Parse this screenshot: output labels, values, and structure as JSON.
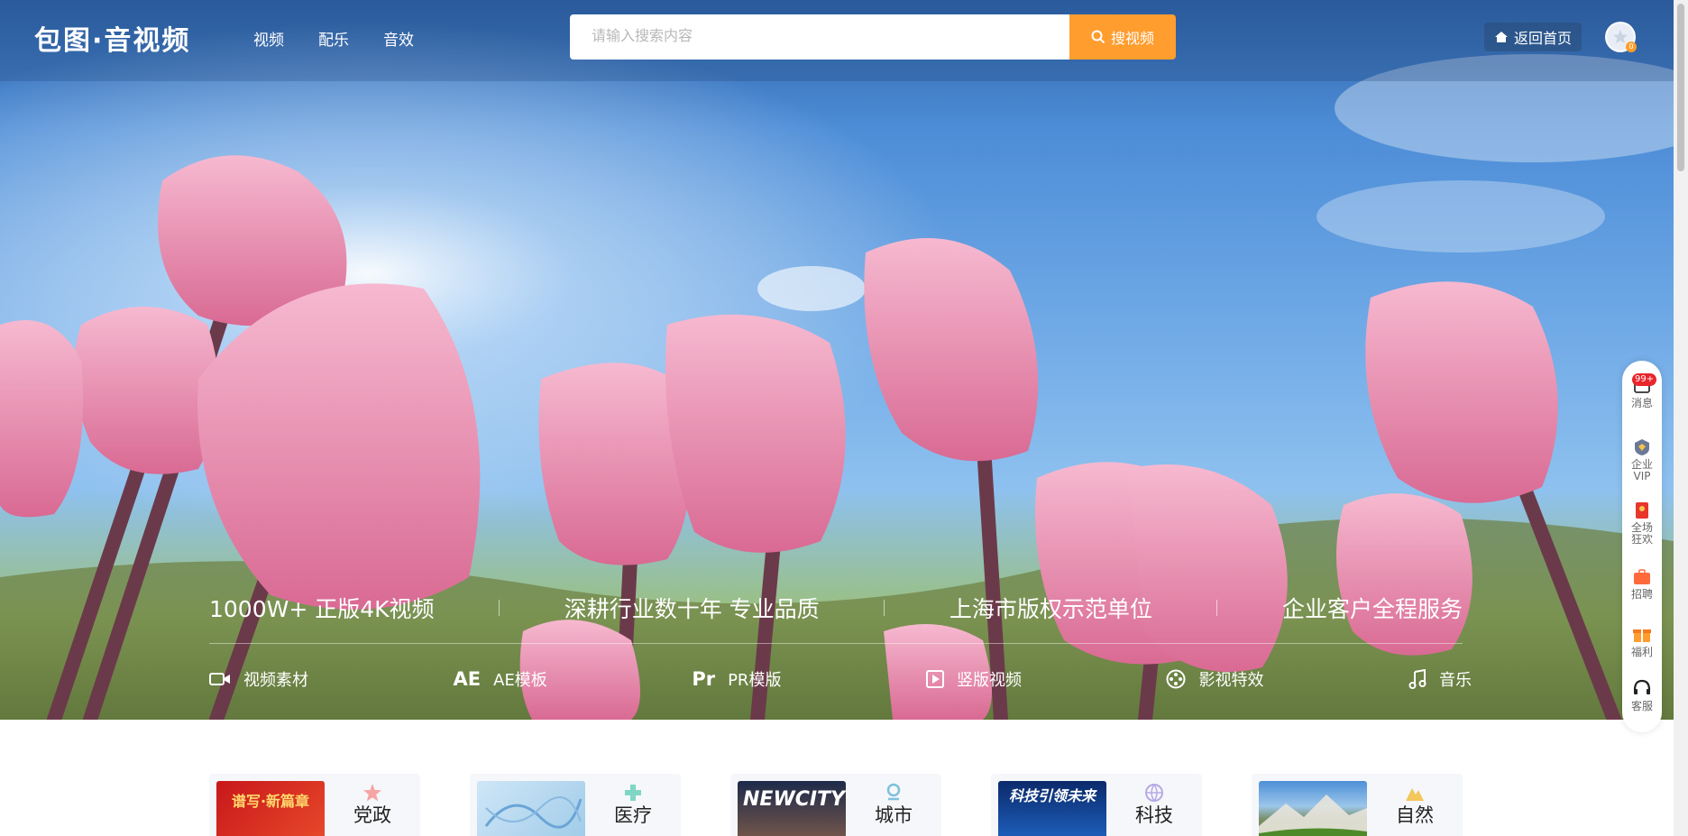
{
  "logo": "包图·音视频",
  "nav": [
    "视频",
    "配乐",
    "音效"
  ],
  "search": {
    "placeholder": "请输入搜索内容",
    "button": "搜视频"
  },
  "home_button": "返回首页",
  "avatar_badge": "0",
  "slogans": [
    "1000W+ 正版4K视频",
    "深耕行业数十年 专业品质",
    "上海市版权示范单位",
    "企业客户全程服务"
  ],
  "categories": [
    {
      "icon": "video-camera-icon",
      "label": "视频素材"
    },
    {
      "icon_text": "AE",
      "label": "AE模板"
    },
    {
      "icon_text": "Pr",
      "label": "PR模版"
    },
    {
      "icon": "play-square-icon",
      "label": "竖版视频"
    },
    {
      "icon": "film-reel-icon",
      "label": "影视特效"
    },
    {
      "icon": "music-note-icon",
      "label": "音乐"
    }
  ],
  "sidebar": {
    "message_badge": "99+",
    "items": [
      "消息",
      "企业VIP",
      "全场狂欢",
      "招聘",
      "福利",
      "客服"
    ]
  },
  "industry_cards": [
    {
      "label": "党政",
      "thumb_text": "谱写·新篇章"
    },
    {
      "label": "医疗",
      "thumb_text": ""
    },
    {
      "label": "城市",
      "thumb_text": "NEWCITY"
    },
    {
      "label": "科技",
      "thumb_text": "科技引领未来"
    },
    {
      "label": "自然",
      "thumb_text": ""
    }
  ],
  "colors": {
    "accent": "#ff9d2e",
    "badge": "#e8262b"
  }
}
